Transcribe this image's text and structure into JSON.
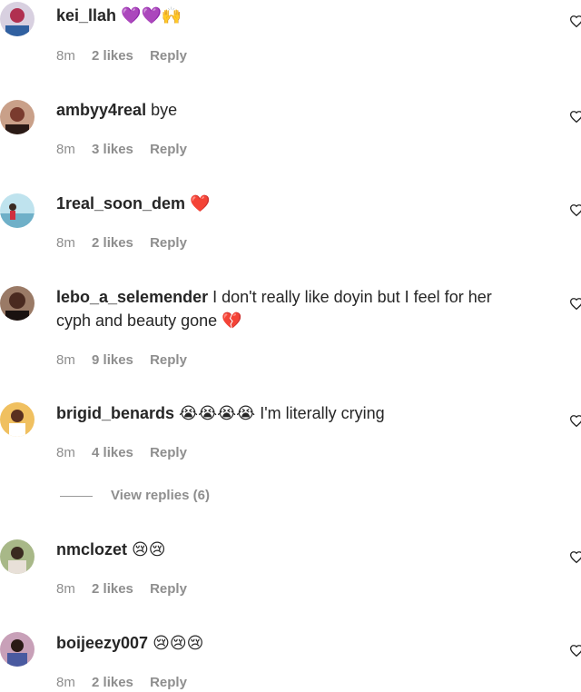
{
  "comments": [
    {
      "username": "kei_llah",
      "text": "",
      "emoji": "💜💜🙌",
      "time": "8m",
      "likes": "2 likes",
      "reply": "Reply",
      "avatar_color": "#b03050"
    },
    {
      "username": "ambyy4real",
      "text": "bye",
      "emoji": "",
      "time": "8m",
      "likes": "3 likes",
      "reply": "Reply",
      "avatar_color": "#7a3b2e"
    },
    {
      "username": "1real_soon_dem",
      "text": "",
      "emoji": "❤️",
      "time": "8m",
      "likes": "2 likes",
      "reply": "Reply",
      "avatar_color": "#6fb0c8"
    },
    {
      "username": "lebo_a_selemender",
      "text": "I don't really like doyin but I feel for her",
      "text2": "cyph and beauty gone",
      "emoji": "💔",
      "time": "8m",
      "likes": "9 likes",
      "reply": "Reply",
      "avatar_color": "#4a2a20"
    },
    {
      "username": "brigid_benards",
      "text": "I'm literally crying",
      "emoji": "😭😭😭😭",
      "time": "8m",
      "likes": "4 likes",
      "reply": "Reply",
      "avatar_color": "#e6a93a"
    },
    {
      "username": "nmclozet",
      "text": "",
      "emoji": "😢😢",
      "time": "8m",
      "likes": "2 likes",
      "reply": "Reply",
      "avatar_color": "#5a6a3a"
    },
    {
      "username": "boijeezy007",
      "text": "",
      "emoji": "😢😢😢",
      "time": "8m",
      "likes": "2 likes",
      "reply": "Reply",
      "avatar_color": "#4a5aa0"
    }
  ],
  "view_replies": "View replies (6)",
  "like_icon": "heart-outline-icon"
}
